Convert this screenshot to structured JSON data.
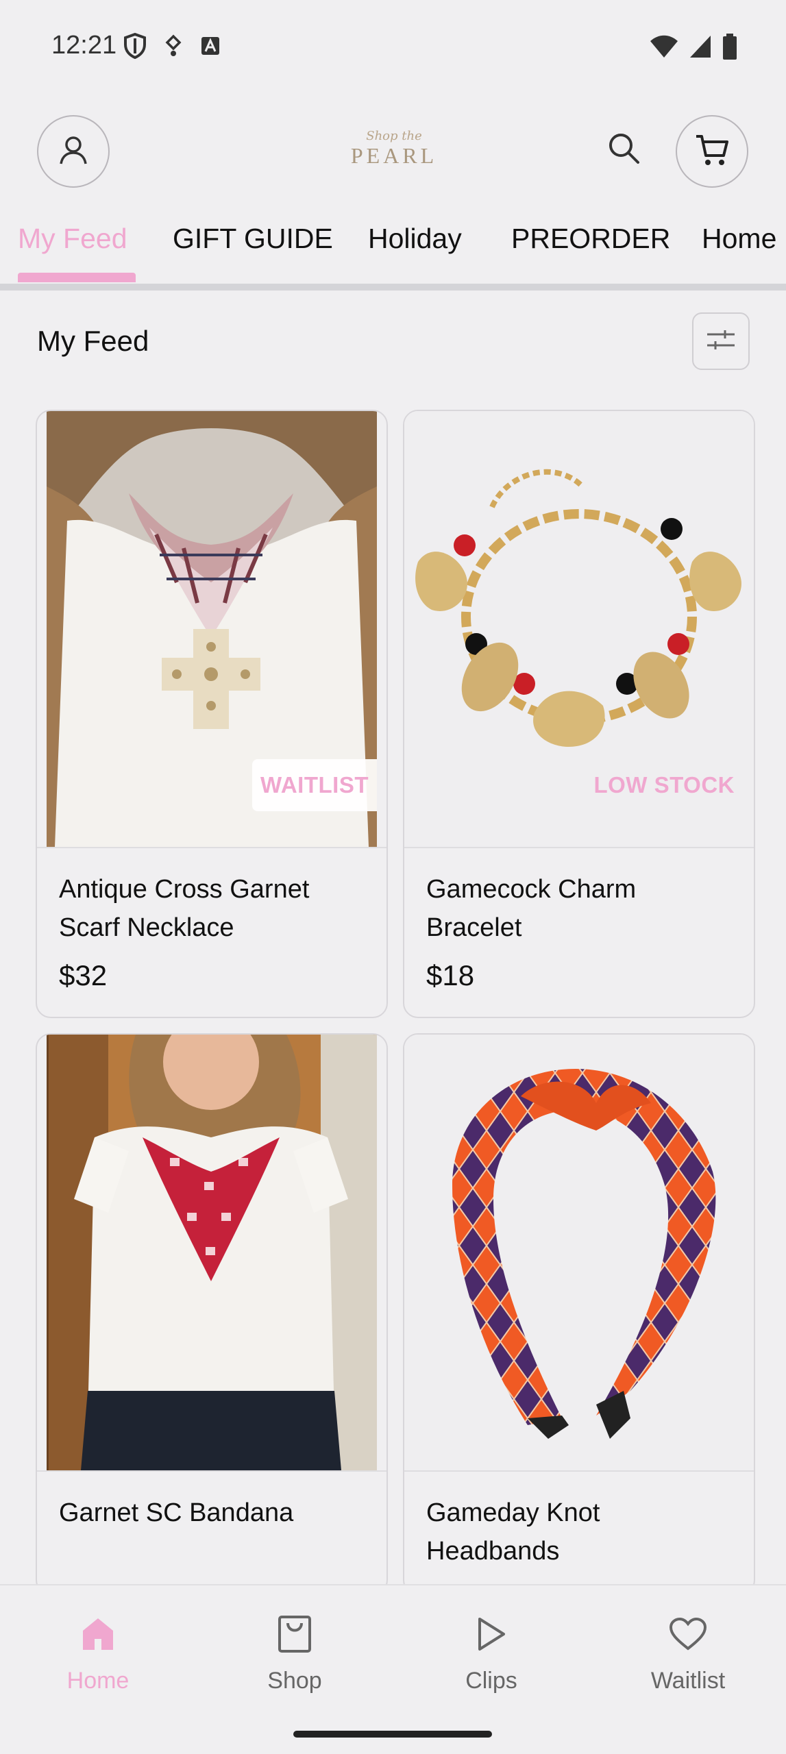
{
  "status_bar": {
    "time": "12:21"
  },
  "header": {
    "logo_script": "Shop the",
    "logo_main": "PEARL"
  },
  "tabs": [
    {
      "label": "My Feed",
      "active": true
    },
    {
      "label": "GIFT GUIDE"
    },
    {
      "label": "Holiday"
    },
    {
      "label": "PREORDER"
    },
    {
      "label": "Home"
    }
  ],
  "section": {
    "title": "My Feed"
  },
  "products": [
    {
      "title": "Antique Cross Garnet Scarf Necklace",
      "price": "$32",
      "badge": "WAITLIST"
    },
    {
      "title": "Gamecock Charm Bracelet",
      "price": "$18",
      "badge": "LOW STOCK"
    },
    {
      "title": "Garnet SC Bandana",
      "price": "",
      "badge": ""
    },
    {
      "title": "Gameday Knot Headbands",
      "price": "",
      "badge": ""
    }
  ],
  "bottom_nav": [
    {
      "label": "Home",
      "icon": "home-icon",
      "active": true
    },
    {
      "label": "Shop",
      "icon": "shopping-bag-icon"
    },
    {
      "label": "Clips",
      "icon": "play-icon"
    },
    {
      "label": "Waitlist",
      "icon": "heart-icon"
    }
  ],
  "colors": {
    "accent": "#f0a7cf",
    "background": "#f0eff1"
  }
}
